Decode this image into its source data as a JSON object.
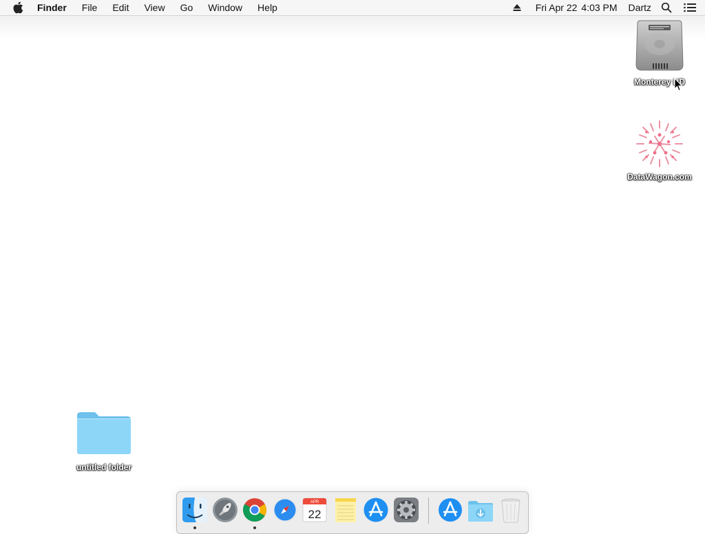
{
  "menubar": {
    "apple_icon": "apple-icon",
    "app_name": "Finder",
    "menus": [
      "File",
      "Edit",
      "View",
      "Go",
      "Window",
      "Help"
    ],
    "eject_icon": "eject-icon",
    "date": "Fri Apr 22",
    "time": "4:03 PM",
    "user": "Dartz",
    "search_icon": "spotlight-search-icon",
    "notifications_icon": "notification-center-icon"
  },
  "desktop": {
    "icons": [
      {
        "label": "Monterey HD",
        "icon": "hard-drive-icon"
      },
      {
        "label": "DataWagon.com",
        "icon": "network-volume-icon"
      },
      {
        "label": "untitled folder",
        "icon": "folder-icon"
      }
    ]
  },
  "dock": {
    "items": [
      {
        "name": "finder",
        "icon": "finder-icon",
        "running": true
      },
      {
        "name": "launchpad",
        "icon": "launchpad-icon",
        "running": false
      },
      {
        "name": "chrome",
        "icon": "chrome-icon",
        "running": true
      },
      {
        "name": "safari",
        "icon": "safari-icon",
        "running": false
      },
      {
        "name": "calendar",
        "icon": "calendar-icon",
        "running": false,
        "month": "APR",
        "day": "22"
      },
      {
        "name": "notes",
        "icon": "notes-icon",
        "running": false
      },
      {
        "name": "app-store",
        "icon": "app-store-icon",
        "running": false
      },
      {
        "name": "system-preferences",
        "icon": "gear-icon",
        "running": false
      },
      {
        "name": "app-store-update",
        "icon": "app-store-icon",
        "running": false
      },
      {
        "name": "downloads",
        "icon": "downloads-folder-icon",
        "running": false
      },
      {
        "name": "trash",
        "icon": "trash-icon",
        "running": false
      }
    ]
  },
  "colors": {
    "menubar_bg": "#f6f6f6",
    "desktop_bg": "#ffffff",
    "folder_blue": "#7ccff5",
    "dock_bg": "#ececec"
  }
}
